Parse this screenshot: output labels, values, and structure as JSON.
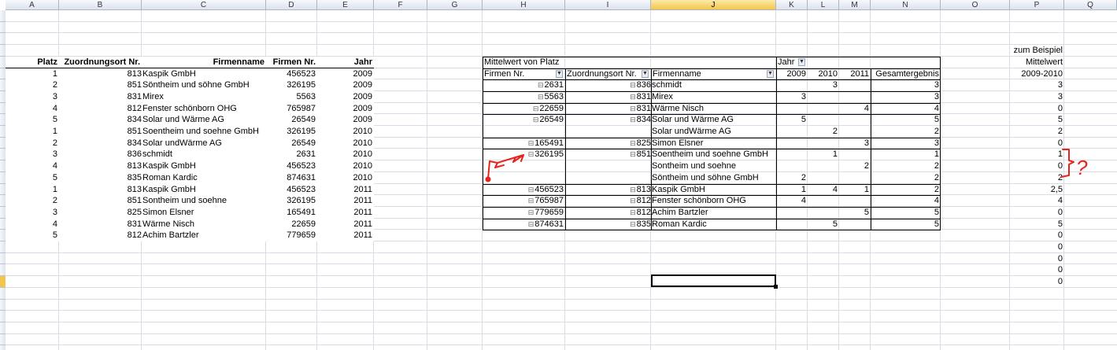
{
  "columns": [
    "A",
    "B",
    "C",
    "D",
    "E",
    "F",
    "G",
    "H",
    "I",
    "J",
    "K",
    "L",
    "M",
    "N",
    "O",
    "P",
    "Q"
  ],
  "selected_column": "J",
  "source_table": {
    "headers": [
      "Platz",
      "Zuordnungsort Nr.",
      "Firmenname",
      "Firmen Nr.",
      "Jahr"
    ],
    "rows": [
      [
        "1",
        "813",
        "Kaspik GmbH",
        "456523",
        "2009"
      ],
      [
        "2",
        "851",
        "Söntheim und söhne GmbH",
        "326195",
        "2009"
      ],
      [
        "3",
        "831",
        "Mirex",
        "5563",
        "2009"
      ],
      [
        "4",
        "812",
        "Fenster schönborn OHG",
        "765987",
        "2009"
      ],
      [
        "5",
        "834",
        "Solar und Wärme AG",
        "26549",
        "2009"
      ],
      [
        "1",
        "851",
        "Soentheim und soehne GmbH",
        "326195",
        "2010"
      ],
      [
        "2",
        "834",
        "Solar undWärme AG",
        "26549",
        "2010"
      ],
      [
        "3",
        "836",
        "schmidt",
        "2631",
        "2010"
      ],
      [
        "4",
        "813",
        "Kaspik GmbH",
        "456523",
        "2010"
      ],
      [
        "5",
        "835",
        "Roman Kardic",
        "874631",
        "2010"
      ],
      [
        "1",
        "813",
        "Kaspik GmbH",
        "456523",
        "2011"
      ],
      [
        "2",
        "851",
        "Sontheim und soehne",
        "326195",
        "2011"
      ],
      [
        "3",
        "825",
        "Simon Elsner",
        "165491",
        "2011"
      ],
      [
        "4",
        "831",
        "Wärme Nisch",
        "22659",
        "2011"
      ],
      [
        "5",
        "812",
        "Achim Bartzler",
        "779659",
        "2011"
      ]
    ]
  },
  "pivot": {
    "title": "Mittelwert von Platz",
    "jahr_label": "Jahr",
    "headers": {
      "firmen_nr": "Firmen Nr.",
      "zuordnungsort": "Zuordnungsort Nr.",
      "firmenname": "Firmenname",
      "y2009": "2009",
      "y2010": "2010",
      "y2011": "2011",
      "total": "Gesamtergebnis"
    },
    "expand_glyph": "⊟",
    "rows": [
      {
        "firmen_nr": "2631",
        "zuordnungsort": "836",
        "firmenname": "schmidt",
        "y2009": "",
        "y2010": "3",
        "y2011": "",
        "total": "3"
      },
      {
        "firmen_nr": "5563",
        "zuordnungsort": "831",
        "firmenname": "Mirex",
        "y2009": "3",
        "y2010": "",
        "y2011": "",
        "total": "3"
      },
      {
        "firmen_nr": "22659",
        "zuordnungsort": "831",
        "firmenname": "Wärme Nisch",
        "y2009": "",
        "y2010": "",
        "y2011": "4",
        "total": "4"
      },
      {
        "firmen_nr": "26549",
        "zuordnungsort": "834",
        "firmenname": "Solar und Wärme AG",
        "y2009": "5",
        "y2010": "",
        "y2011": "",
        "total": "5"
      },
      {
        "firmen_nr": "",
        "zuordnungsort": "",
        "firmenname": "Solar undWärme AG",
        "y2009": "",
        "y2010": "2",
        "y2011": "",
        "total": "2"
      },
      {
        "firmen_nr": "165491",
        "zuordnungsort": "825",
        "firmenname": "Simon Elsner",
        "y2009": "",
        "y2010": "",
        "y2011": "3",
        "total": "3"
      },
      {
        "firmen_nr": "326195",
        "zuordnungsort": "851",
        "firmenname": "Soentheim und soehne GmbH",
        "y2009": "",
        "y2010": "1",
        "y2011": "",
        "total": "1"
      },
      {
        "firmen_nr": "",
        "zuordnungsort": "",
        "firmenname": "Sontheim und soehne",
        "y2009": "",
        "y2010": "",
        "y2011": "2",
        "total": "2"
      },
      {
        "firmen_nr": "",
        "zuordnungsort": "",
        "firmenname": "Söntheim und söhne GmbH",
        "y2009": "2",
        "y2010": "",
        "y2011": "",
        "total": "2"
      },
      {
        "firmen_nr": "456523",
        "zuordnungsort": "813",
        "firmenname": "Kaspik GmbH",
        "y2009": "1",
        "y2010": "4",
        "y2011": "1",
        "total": "2"
      },
      {
        "firmen_nr": "765987",
        "zuordnungsort": "812",
        "firmenname": "Fenster schönborn OHG",
        "y2009": "4",
        "y2010": "",
        "y2011": "",
        "total": "4"
      },
      {
        "firmen_nr": "779659",
        "zuordnungsort": "812",
        "firmenname": "Achim Bartzler",
        "y2009": "",
        "y2010": "",
        "y2011": "5",
        "total": "5"
      },
      {
        "firmen_nr": "874631",
        "zuordnungsort": "835",
        "firmenname": "Roman Kardic",
        "y2009": "",
        "y2010": "5",
        "y2011": "",
        "total": "5"
      }
    ]
  },
  "side_column": {
    "header_lines": [
      "zum Beispiel",
      "Mittelwert",
      "2009-2010"
    ],
    "values": [
      "3",
      "3",
      "0",
      "5",
      "2",
      "0",
      "1",
      "0",
      "2",
      "2,5",
      "4",
      "0",
      "5",
      "0",
      "0",
      "0",
      "0",
      "0"
    ]
  },
  "annotations": {
    "question_mark": "?",
    "ink_color": "#e8221d"
  }
}
